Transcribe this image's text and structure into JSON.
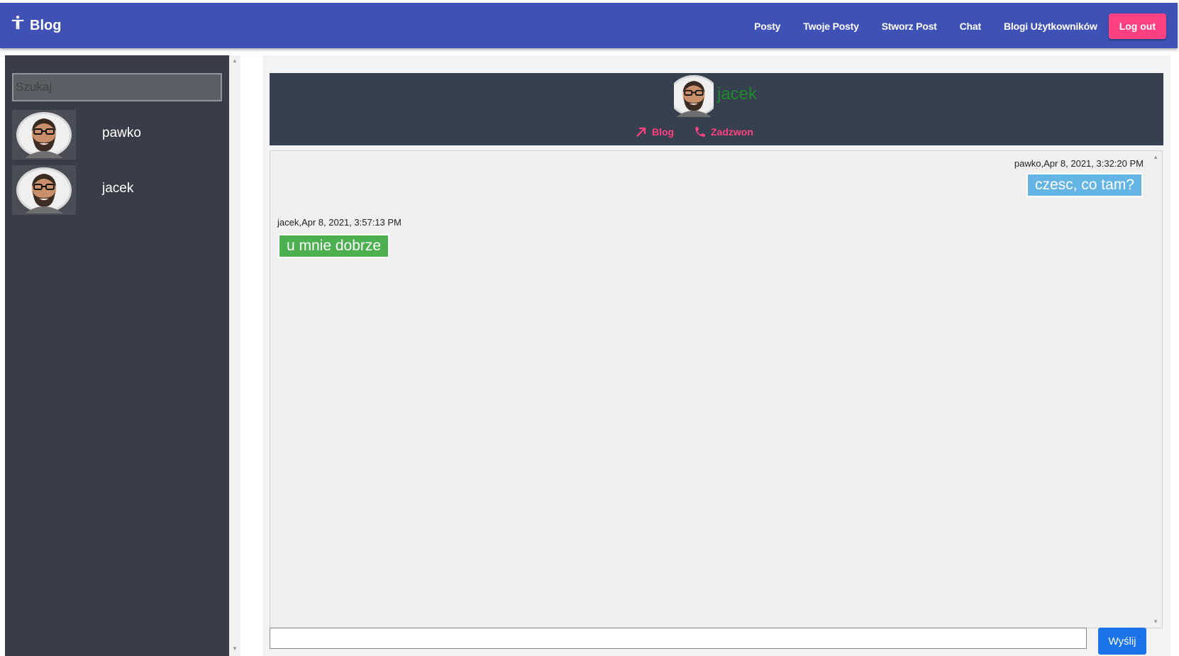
{
  "navbar": {
    "brand_icon": "accessibility-icon",
    "title": "Blog",
    "links": [
      "Posty",
      "Twoje Posty",
      "Stworz Post",
      "Chat",
      "Blogi Użytkowników"
    ],
    "logout_label": "Log out",
    "colors": {
      "background": "#3f51b5",
      "logout": "#ff4081"
    }
  },
  "sidebar": {
    "search_placeholder": "Szukaj",
    "users": [
      {
        "name": "pawko",
        "avatar": "user-avatar-photo"
      },
      {
        "name": "jacek",
        "avatar": "user-avatar-photo"
      }
    ]
  },
  "chat": {
    "header": {
      "name": "jacek",
      "blog_label": "Blog",
      "call_label": "Zadzwon",
      "blog_icon": "arrow-up-right-icon",
      "call_icon": "phone-icon"
    },
    "messages": [
      {
        "meta": "pawko,Apr 8, 2021, 3:32:20 PM",
        "text": "czesc, co tam?",
        "align": "right",
        "color": "#64b5e6"
      },
      {
        "meta": "jacek,Apr 8, 2021, 3:57:13 PM",
        "text": "u mnie dobrze",
        "align": "left",
        "color": "#4caf50"
      }
    ],
    "input_value": "",
    "send_label": "Wyślij"
  }
}
